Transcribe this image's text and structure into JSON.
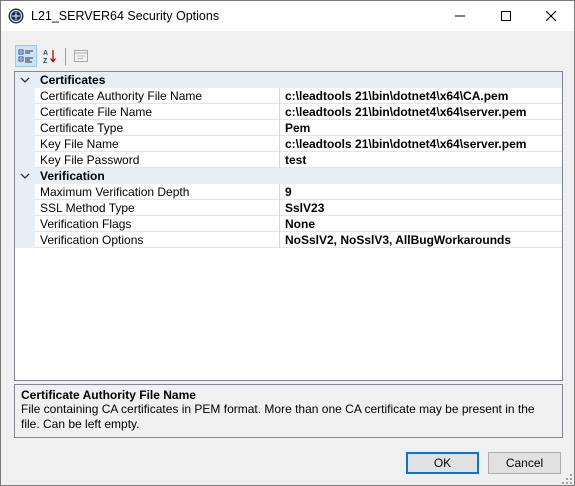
{
  "window": {
    "title": "L21_SERVER64 Security Options",
    "app_icon": "lead-logo-icon",
    "controls": [
      "minimize-icon",
      "maximize-icon",
      "close-icon"
    ]
  },
  "toolbar": {
    "buttons": [
      {
        "name": "categorized-view",
        "icon": "categorized-icon",
        "active": true
      },
      {
        "name": "alphabetical-view",
        "icon": "sort-az-icon",
        "active": false
      },
      {
        "name": "property-pages",
        "icon": "property-pages-icon",
        "active": false,
        "enabled": false
      }
    ]
  },
  "property_grid": {
    "categories": [
      {
        "label": "Certificates",
        "expanded": true,
        "properties": [
          {
            "name": "Certificate Authority File Name",
            "value": "c:\\leadtools 21\\bin\\dotnet4\\x64\\CA.pem"
          },
          {
            "name": "Certificate File Name",
            "value": "c:\\leadtools 21\\bin\\dotnet4\\x64\\server.pem"
          },
          {
            "name": "Certificate Type",
            "value": "Pem"
          },
          {
            "name": "Key File Name",
            "value": "c:\\leadtools 21\\bin\\dotnet4\\x64\\server.pem"
          },
          {
            "name": "Key File Password",
            "value": "test"
          }
        ]
      },
      {
        "label": "Verification",
        "expanded": true,
        "properties": [
          {
            "name": "Maximum Verification Depth",
            "value": "9"
          },
          {
            "name": "SSL Method Type",
            "value": "SslV23"
          },
          {
            "name": "Verification Flags",
            "value": "None"
          },
          {
            "name": "Verification Options",
            "value": "NoSslV2, NoSslV3, AllBugWorkarounds"
          }
        ]
      }
    ]
  },
  "description": {
    "title": "Certificate Authority File Name",
    "text": "File containing CA certificates in PEM format. More than one CA certificate may be present in the file. Can be left empty."
  },
  "buttons": {
    "ok": "OK",
    "cancel": "Cancel"
  },
  "colors": {
    "accent": "#0078d7",
    "category_bg": "#e8eef7"
  }
}
